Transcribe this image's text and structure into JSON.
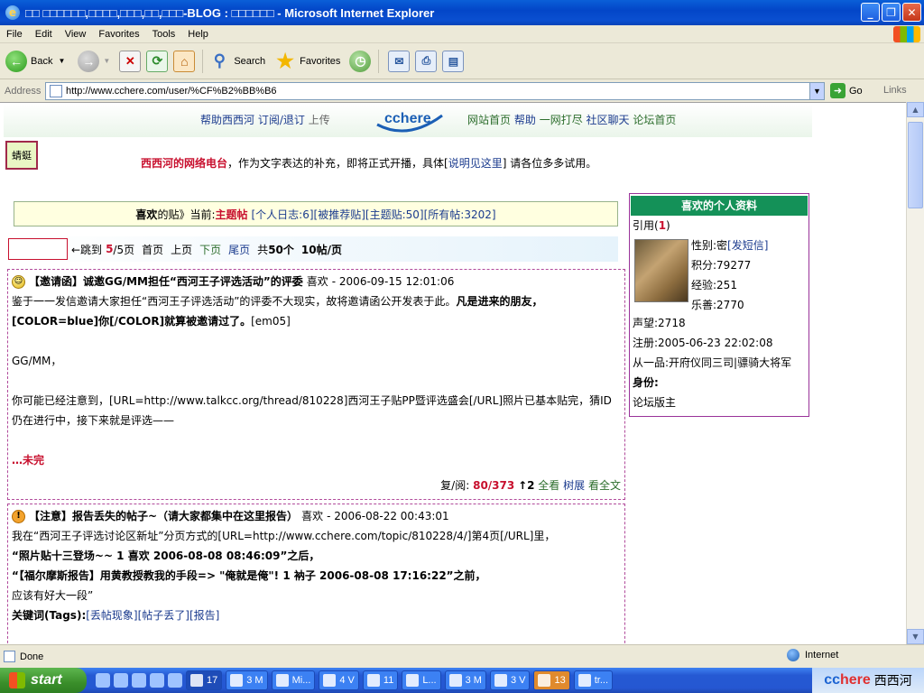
{
  "window": {
    "title": "□□ □□□□□□,□□□□,□□□,□□,□□□-BLOG : □□□□□□ - Microsoft Internet Explorer"
  },
  "menu": [
    "File",
    "Edit",
    "View",
    "Favorites",
    "Tools",
    "Help"
  ],
  "toolbar": {
    "back": "Back",
    "search": "Search",
    "favorites": "Favorites"
  },
  "address": {
    "label": "Address",
    "url": "http://www.cchere.com/user/%CF%B2%BB%B6",
    "go": "Go",
    "links": "Links"
  },
  "nav": {
    "left": [
      "帮助西西河",
      "订阅/退订",
      "上传"
    ],
    "logo": "cchere",
    "right": [
      "网站首页",
      "帮助",
      "一网打尽",
      "社区聊天",
      "论坛首页"
    ]
  },
  "tag_button": "蜻蜓",
  "radio": {
    "name": "西西河的网络电台",
    "text1": "，作为文字表达的补充，即将正式开播，具体[",
    "link": "说明见这里",
    "text2": "] 请各位多多试用。"
  },
  "filter": {
    "user": "喜欢",
    "text": " 的贴》当前:",
    "current": "主题帖",
    "items": [
      "[个人日志:6]",
      "[被推荐贴]",
      "[主题贴:50]",
      "[所有帖:3202]"
    ]
  },
  "pager": {
    "jump": "←跳到",
    "current_page": "5",
    "total": "/5页",
    "first": "首页",
    "prev": "上页",
    "next": "下页",
    "last": "尾页",
    "count_prefix": "共",
    "count": "50个",
    "per_page": "10帖/页"
  },
  "posts": [
    {
      "title": "【邀请函】诚邀GG/MM担任“西河王子评选活动”的评委",
      "author": "喜欢",
      "date": "- 2006-09-15 12:01:06",
      "line1a": "鉴于一一发信邀请大家担任“西河王子评选活动”的评委不大现实，故将邀请函公开发表于此。",
      "line1b": "凡是进来的朋友，[COLOR=blue]你[/COLOR]就算被邀请过了。",
      "line1c": "[em05]",
      "line2": "GG/MM，",
      "line3": "你可能已经注意到，[URL=http://www.talkcc.org/thread/810228]西河王子贴PP暨评选盛会[/URL]照片已基本贴完，猜ID仍在进行中，接下来就是评选——",
      "more": "…未完",
      "stats_label": "复/阅:",
      "stats": "80/373",
      "arrow": "↑2",
      "footer": [
        "全看",
        "树展",
        "看全文"
      ]
    },
    {
      "title": "【注意】报告丢失的帖子~（请大家都集中在这里报告）",
      "author": "喜欢",
      "date": "- 2006-08-22 00:43:01",
      "line1": "我在“西河王子评选讨论区新址”分页方式的[URL=http://www.cchere.com/topic/810228/4/]第4页[/URL]里，",
      "line2": "“照片贴十三登场~~ 1 喜欢 2006-08-08 08:46:09”之后，",
      "line3": "“【福尔摩斯报告】用黄教授教我的手段=> \"俺就是俺\"! 1 衲子 2006-08-08 17:16:22”之前，",
      "line4": "应该有好大一段”",
      "tags_label": "关键词(Tags):",
      "tags": [
        "[丢帖现象]",
        "[帖子丢了]",
        "[报告]"
      ]
    }
  ],
  "profile": {
    "header": "喜欢的个人资料",
    "quote_label": "引用(",
    "quote_num": "1",
    "quote_end": ")",
    "gender": "性别:密",
    "sms": "[发短信]",
    "points": "积分:79277",
    "exp": "经验:251",
    "good": "乐善:2770",
    "fame": "声望:2718",
    "registered": "注册:2005-06-23 22:02:08",
    "rank": "从一品:开府仪同三司|骠骑大将军",
    "identity_label": "身份:",
    "identity": "论坛版主"
  },
  "status": {
    "text": "Done",
    "zone": "Internet"
  },
  "taskbar": {
    "start": "start",
    "tasks": [
      "17",
      "3 M",
      "Mi...",
      "4 V",
      "11",
      "L...",
      "3 M",
      "3 V",
      "13",
      "tr..."
    ],
    "tray": {
      "cc": "cc",
      "here": "here",
      "name": "西西河"
    }
  }
}
